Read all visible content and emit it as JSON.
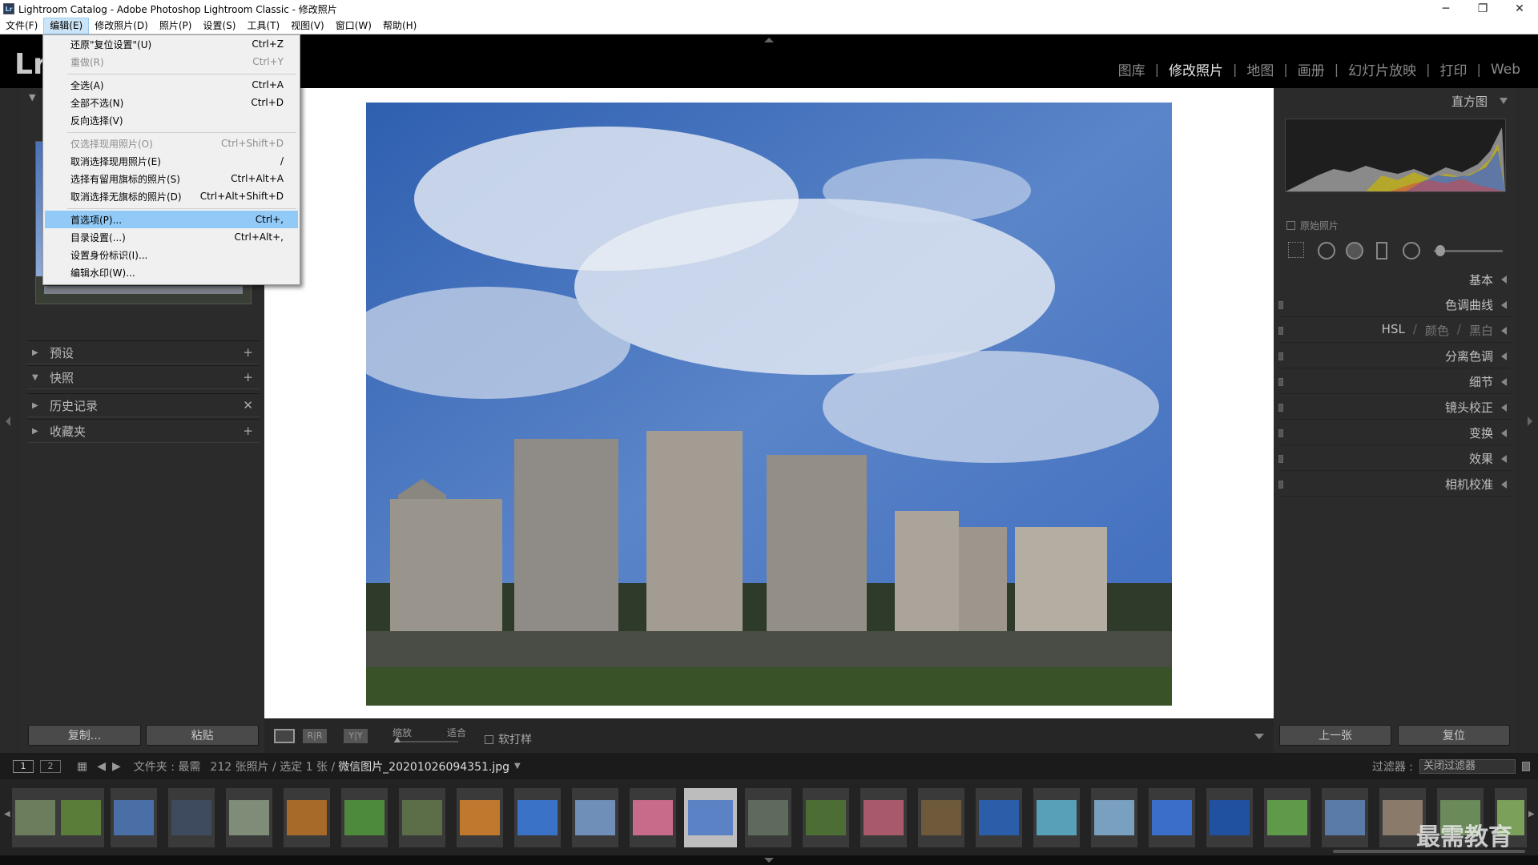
{
  "window": {
    "title": "Lightroom Catalog - Adobe Photoshop Lightroom Classic - 修改照片",
    "app_icon": "Lr",
    "controls": [
      "─",
      "❐",
      "✕"
    ]
  },
  "menubar": [
    "文件(F)",
    "编辑(E)",
    "修改照片(D)",
    "照片(P)",
    "设置(S)",
    "工具(T)",
    "视图(V)",
    "窗口(W)",
    "帮助(H)"
  ],
  "logo": "Lr",
  "modules": [
    {
      "label": "图库",
      "active": false
    },
    {
      "label": "修改照片",
      "active": true
    },
    {
      "label": "地图",
      "active": false
    },
    {
      "label": "画册",
      "active": false
    },
    {
      "label": "幻灯片放映",
      "active": false
    },
    {
      "label": "打印",
      "active": false
    },
    {
      "label": "Web",
      "active": false
    }
  ],
  "edit_menu": [
    {
      "label": "还原\"复位设置\"(U)",
      "shortcut": "Ctrl+Z",
      "disabled": false
    },
    {
      "label": "重做(R)",
      "shortcut": "Ctrl+Y",
      "disabled": true
    },
    {
      "label": "全选(A)",
      "shortcut": "Ctrl+A",
      "disabled": false
    },
    {
      "label": "全部不选(N)",
      "shortcut": "Ctrl+D",
      "disabled": false
    },
    {
      "label": "反向选择(V)",
      "shortcut": "",
      "disabled": false
    },
    {
      "label": "仅选择现用照片(O)",
      "shortcut": "Ctrl+Shift+D",
      "disabled": true
    },
    {
      "label": "取消选择现用照片(E)",
      "shortcut": "/",
      "disabled": false
    },
    {
      "label": "选择有留用旗标的照片(S)",
      "shortcut": "Ctrl+Alt+A",
      "disabled": false
    },
    {
      "label": "取消选择无旗标的照片(D)",
      "shortcut": "Ctrl+Alt+Shift+D",
      "disabled": false
    },
    {
      "label": "首选项(P)...",
      "shortcut": "Ctrl+,",
      "disabled": false,
      "highlighted": true
    },
    {
      "label": "目录设置(...)",
      "shortcut": "Ctrl+Alt+,",
      "disabled": false
    },
    {
      "label": "设置身份标识(I)...",
      "shortcut": "",
      "disabled": false
    },
    {
      "label": "编辑水印(W)...",
      "shortcut": "",
      "disabled": false
    }
  ],
  "left_panel": {
    "sections": [
      {
        "label": "预设",
        "expanded": false,
        "action": "+"
      },
      {
        "label": "快照",
        "expanded": true,
        "action": "+"
      },
      {
        "label": "历史记录",
        "expanded": false,
        "action": "✕"
      },
      {
        "label": "收藏夹",
        "expanded": false,
        "action": "+"
      }
    ],
    "copy_button": "复制...",
    "paste_button": "粘贴"
  },
  "right_panel": {
    "histogram_label": "直方图",
    "original_photo_label": "原始照片",
    "panels": [
      "基本",
      "色调曲线",
      "HSL",
      "颜色",
      "黑白",
      "分离色调",
      "细节",
      "镜头校正",
      "变换",
      "效果",
      "相机校准"
    ],
    "prev_button": "上一张",
    "reset_button": "复位"
  },
  "toolbar": {
    "zoom_label": "缩放",
    "fit_label": "适合",
    "softproof_label": "软打样",
    "compare_labels": [
      "R|R",
      "Y|Y"
    ]
  },
  "filmstrip_bar": {
    "page1": "1",
    "page2": "2",
    "source_label": "文件夹 : 最需",
    "count_label": "212 张照片 / 选定 1 张 /",
    "filename": "微信图片_20201026094351.jpg",
    "filter_label": "过滤器 :",
    "filter_value": "关闭过滤器"
  },
  "watermark": "最需教育",
  "colors": {
    "menu_highlight": "#91c9f7",
    "panel_bg": "#2b2b2b",
    "active_module": "#e6e6e6"
  }
}
